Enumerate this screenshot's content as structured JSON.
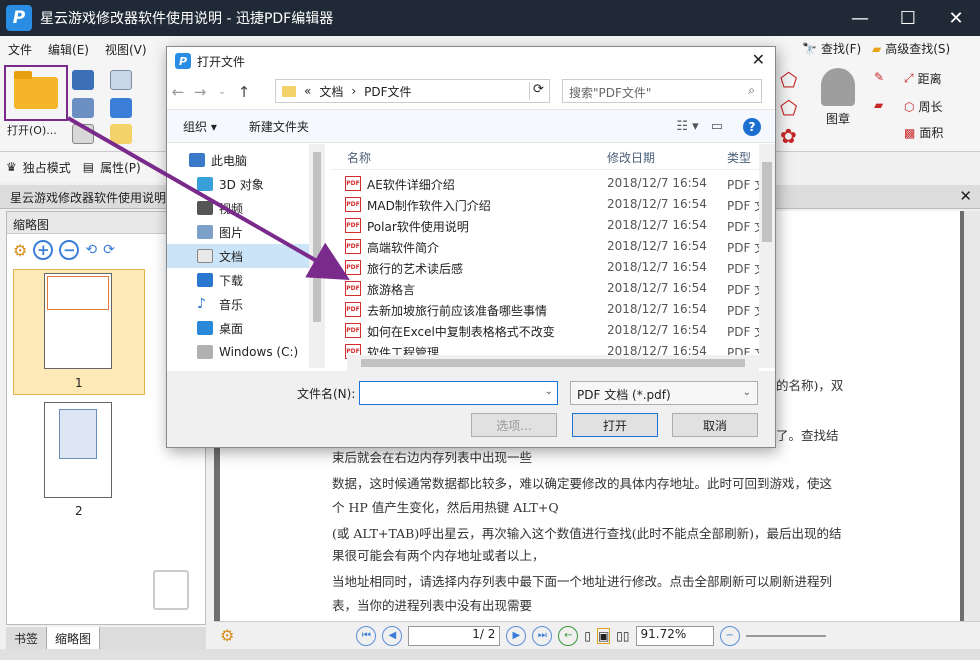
{
  "app": {
    "title": "星云游戏修改器软件使用说明 - 迅捷PDF编辑器",
    "logo": "P"
  },
  "menubar": [
    "文件",
    "编辑(E)",
    "视图(V)"
  ],
  "ribbon": {
    "open_label": "打开(O)...",
    "find_label": "查找(F)",
    "adv_find_label": "高级查找(S)",
    "stamp_label": "图章",
    "distance_label": "距离",
    "perimeter_label": "周长",
    "area_label": "面积",
    "exclusive_mode": "独占模式",
    "properties": "属性(P)"
  },
  "doc_tab": {
    "label": "星云游戏修改器软件使用说明"
  },
  "left_panel": {
    "title": "缩略图",
    "thumbs": [
      "1",
      "2"
    ],
    "tabs": [
      "书签",
      "缩略图"
    ]
  },
  "document": {
    "lines": [
      "的名称)，双",
      "了。查找结",
      "束后就会在右边内存列表中出现一些",
      "数据，这时候通常数据都比较多，难以确定要修改的具体内存地址。此时可回到游戏，使这",
      "个 HP 值产生变化，然后用热键 ALT+Q",
      "(或 ALT+TAB)呼出星云，再次输入这个数值进行查找(此时不能点全部刷新)，最后出现的结",
      "果很可能会有两个内存地址或者以上，",
      "当地址相同时，请选择内存列表中最下面一个地址进行修改。点击全部刷新可以刷新进程列",
      "表，当你的进程列表中没有出现需要"
    ]
  },
  "status": {
    "page_value": "1",
    "page_total": "/ 2",
    "zoom": "91.72%"
  },
  "dialog": {
    "title": "打开文件",
    "address": {
      "prefix": "«",
      "parts": [
        "文档",
        "PDF文件"
      ]
    },
    "search_placeholder": "搜索\"PDF文件\"",
    "organize": "组织",
    "new_folder": "新建文件夹",
    "nav_items": [
      {
        "label": "此电脑",
        "icon": "computer-icon"
      },
      {
        "label": "3D 对象",
        "icon": "cube-icon"
      },
      {
        "label": "视频",
        "icon": "video-icon"
      },
      {
        "label": "图片",
        "icon": "picture-icon"
      },
      {
        "label": "文档",
        "icon": "document-icon"
      },
      {
        "label": "下载",
        "icon": "download-icon"
      },
      {
        "label": "音乐",
        "icon": "music-icon"
      },
      {
        "label": "桌面",
        "icon": "desktop-icon"
      },
      {
        "label": "Windows (C:)",
        "icon": "drive-icon"
      }
    ],
    "columns": {
      "name": "名称",
      "date": "修改日期",
      "type": "类型"
    },
    "files": [
      {
        "name": "AE软件详细介绍",
        "date": "2018/12/7 16:54",
        "type": "PDF 文"
      },
      {
        "name": "MAD制作软件入门介绍",
        "date": "2018/12/7 16:54",
        "type": "PDF 文"
      },
      {
        "name": "Polar软件使用说明",
        "date": "2018/12/7 16:54",
        "type": "PDF 文"
      },
      {
        "name": "高端软件简介",
        "date": "2018/12/7 16:54",
        "type": "PDF 文"
      },
      {
        "name": "旅行的艺术读后感",
        "date": "2018/12/7 16:54",
        "type": "PDF 文"
      },
      {
        "name": "旅游格言",
        "date": "2018/12/7 16:54",
        "type": "PDF 文"
      },
      {
        "name": "去新加坡旅行前应该准备哪些事情",
        "date": "2018/12/7 16:54",
        "type": "PDF 文"
      },
      {
        "name": "如何在Excel中复制表格格式不改变",
        "date": "2018/12/7 16:54",
        "type": "PDF 文"
      },
      {
        "name": "软件工程管理",
        "date": "2018/12/7 16:54",
        "type": "PDF 文"
      }
    ],
    "filename_label": "文件名(N):",
    "filename_value": "",
    "filetype_value": "PDF 文档 (*.pdf)",
    "options_button": "选项...",
    "open_button": "打开",
    "cancel_button": "取消"
  },
  "colors": {
    "accent": "#7a2a8b",
    "titlebar": "#1f2a36"
  }
}
